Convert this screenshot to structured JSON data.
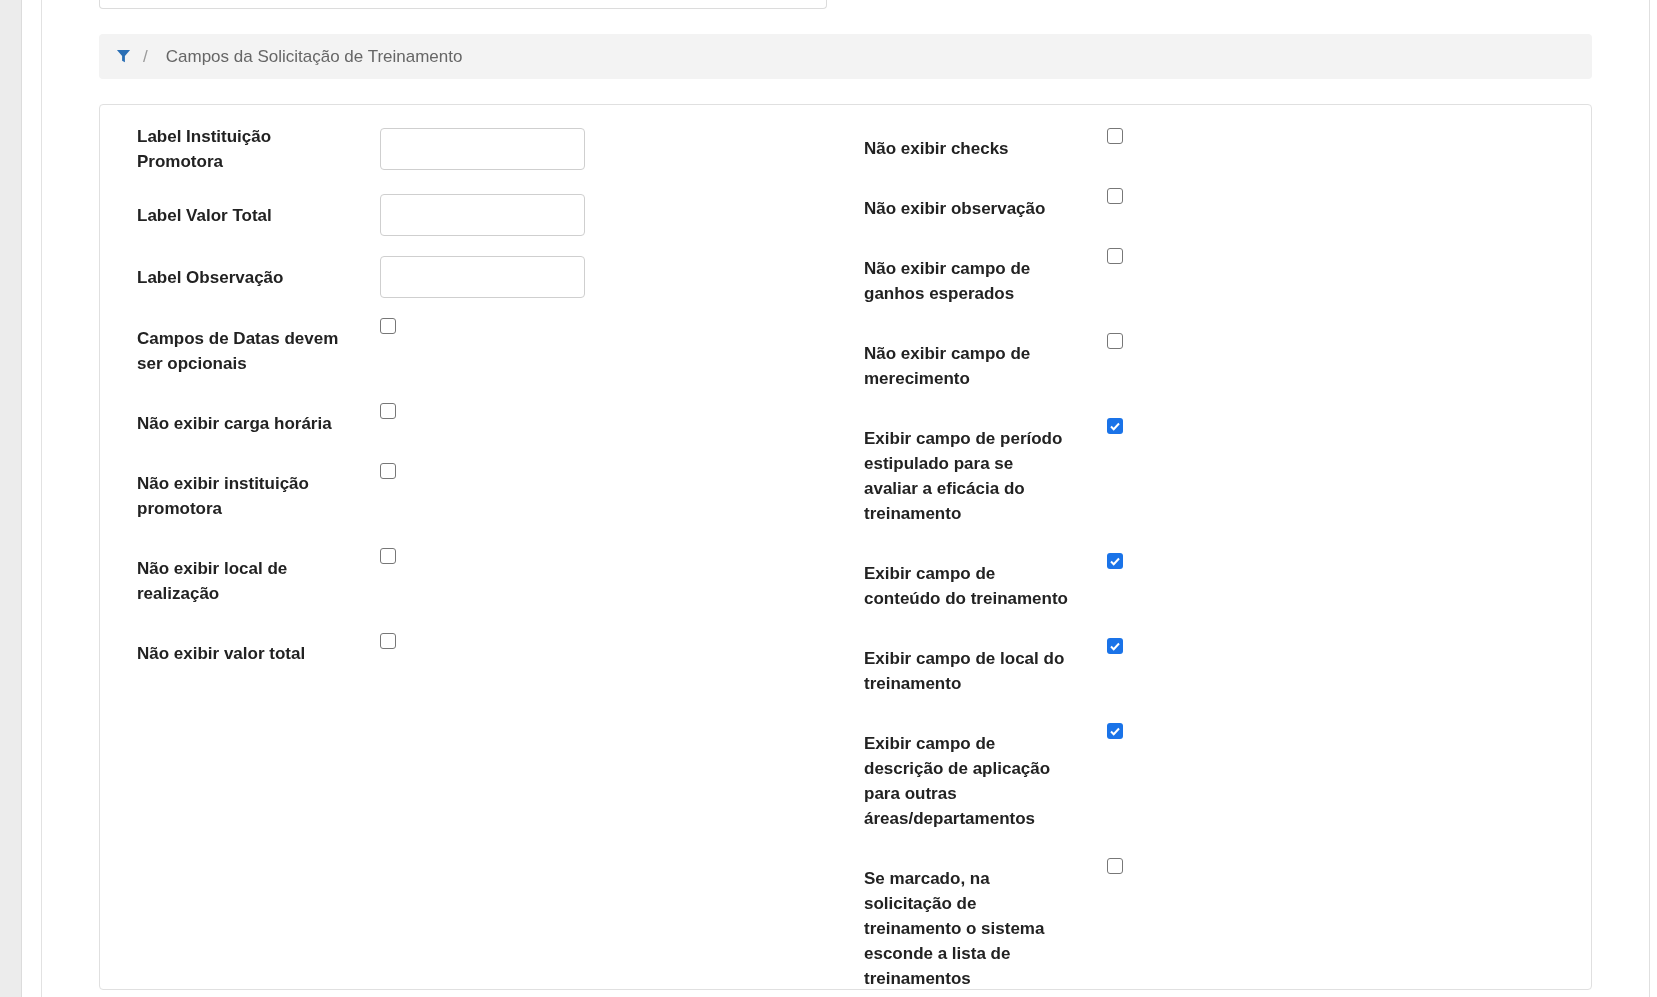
{
  "breadcrumb": {
    "title": "Campos da Solicitação de Treinamento",
    "separator": "/"
  },
  "left_fields": [
    {
      "kind": "text",
      "label": "Label Instituição Promotora"
    },
    {
      "kind": "text",
      "label": "Label Valor Total"
    },
    {
      "kind": "text",
      "label": "Label Observação"
    },
    {
      "kind": "checkbox",
      "label": "Campos de Datas devem ser opcionais",
      "checked": false
    },
    {
      "kind": "checkbox",
      "label": "Não exibir carga horária",
      "checked": false
    },
    {
      "kind": "checkbox",
      "label": "Não exibir instituição promotora",
      "checked": false
    },
    {
      "kind": "checkbox",
      "label": "Não exibir local de realização",
      "checked": false
    },
    {
      "kind": "checkbox",
      "label": "Não exibir valor total",
      "checked": false
    }
  ],
  "right_fields": [
    {
      "kind": "checkbox",
      "label": "Não exibir checks",
      "checked": false
    },
    {
      "kind": "checkbox",
      "label": "Não exibir observação",
      "checked": false
    },
    {
      "kind": "checkbox",
      "label": "Não exibir campo de ganhos esperados",
      "checked": false
    },
    {
      "kind": "checkbox",
      "label": "Não exibir campo de merecimento",
      "checked": false
    },
    {
      "kind": "checkbox",
      "label": "Exibir campo de período estipulado para se avaliar a eficácia do treinamento",
      "checked": true
    },
    {
      "kind": "checkbox",
      "label": "Exibir campo de conteúdo do treinamento",
      "checked": true
    },
    {
      "kind": "checkbox",
      "label": "Exibir campo de local do treinamento",
      "checked": true
    },
    {
      "kind": "checkbox",
      "label": "Exibir campo de descrição de aplicação para outras áreas/departamentos",
      "checked": true
    },
    {
      "kind": "checkbox",
      "label": "Se marcado, na solicitação de treinamento o sistema esconde a lista de treinamentos",
      "checked": false
    }
  ]
}
